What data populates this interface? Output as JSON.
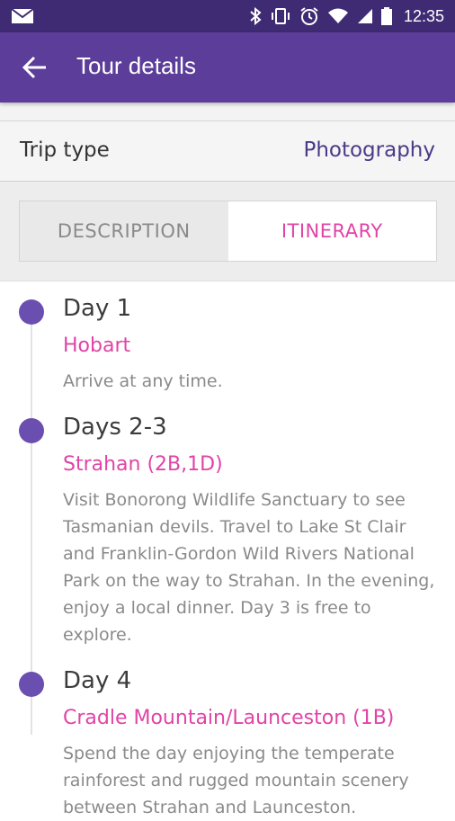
{
  "status_bar": {
    "time": "12:35",
    "icons": [
      "mail-icon",
      "bluetooth-icon",
      "vibrate-icon",
      "alarm-icon",
      "wifi-icon",
      "signal-icon",
      "battery-icon"
    ]
  },
  "app_bar": {
    "title": "Tour details",
    "back_icon": "arrow-left-icon"
  },
  "trip": {
    "label": "Trip type",
    "value": "Photography"
  },
  "tabs": [
    {
      "label": "DESCRIPTION",
      "selected": false
    },
    {
      "label": "ITINERARY",
      "selected": true
    }
  ],
  "itinerary": [
    {
      "day": "Day 1",
      "place": "Hobart",
      "description": "Arrive at any time."
    },
    {
      "day": "Days 2-3",
      "place": "Strahan (2B,1D)",
      "description": "Visit Bonorong Wildlife Sanctuary to see Tasmanian devils. Travel to Lake St Clair and Franklin-Gordon Wild Rivers National Park on the way to Strahan. In the evening, enjoy a local dinner. Day 3 is free to explore."
    },
    {
      "day": "Day 4",
      "place": "Cradle Mountain/Launceston (1B)",
      "description": "Spend the day enjoying the temperate rainforest and rugged mountain scenery between Strahan and Launceston."
    }
  ],
  "colors": {
    "status_bar": "#3f2b73",
    "app_bar": "#5c3d99",
    "accent_pink": "#e044a6",
    "timeline_dot": "#6b4fb0",
    "trip_value": "#4b3a88"
  }
}
